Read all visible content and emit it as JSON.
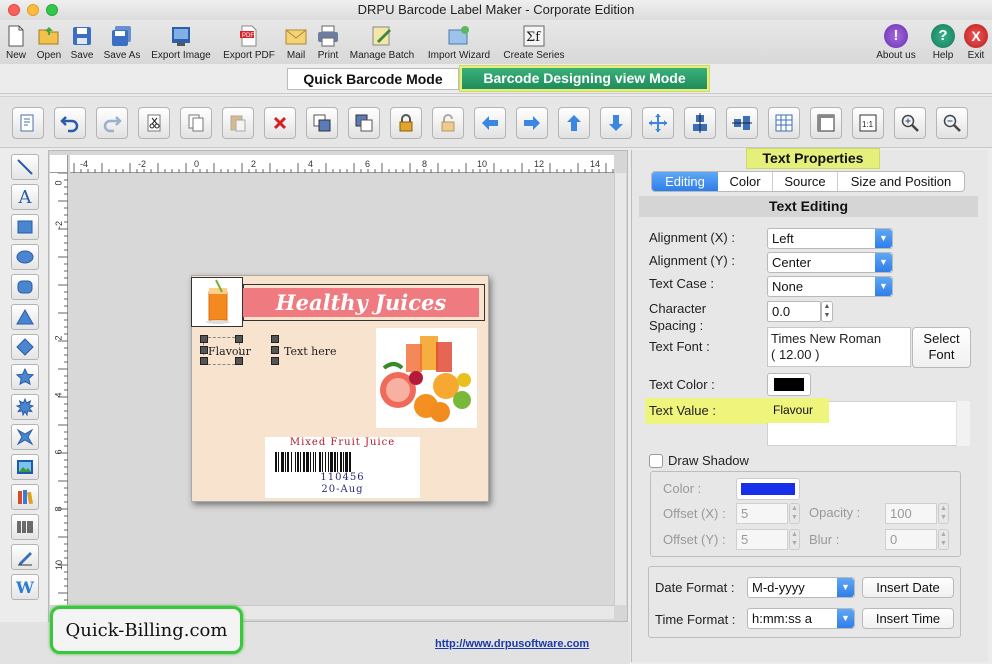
{
  "window": {
    "title": "DRPU Barcode Label Maker - Corporate Edition"
  },
  "toolbar": {
    "new": "New",
    "open": "Open",
    "save": "Save",
    "save_as": "Save As",
    "export_image": "Export Image",
    "export_pdf": "Export PDF",
    "mail": "Mail",
    "print": "Print",
    "manage_batch": "Manage Batch",
    "import_wizard": "Import Wizard",
    "create_series": "Create Series",
    "about_us": "About us",
    "help": "Help",
    "exit": "Exit"
  },
  "modes": {
    "quick": "Quick Barcode Mode",
    "designing": "Barcode Designing view Mode"
  },
  "ruler": {
    "h_ticks": [
      "-4",
      "-2",
      "0",
      "2",
      "4",
      "6",
      "8",
      "10",
      "12",
      "14"
    ],
    "v_ticks": [
      "0",
      "-2",
      "2",
      "4",
      "6",
      "8",
      "10"
    ]
  },
  "label": {
    "header": "Healthy Juices",
    "flavour_text": "Flavour",
    "text_here": "Text here",
    "barcode_title": "Mixed Fruit Juice",
    "barcode_number": "110456",
    "barcode_date": "20-Aug"
  },
  "panel": {
    "heading": "Text Properties",
    "tabs": [
      "Editing",
      "Color",
      "Source",
      "Size and Position"
    ],
    "section_title": "Text Editing",
    "alignment_x_label": "Alignment (X) :",
    "alignment_x_value": "Left",
    "alignment_y_label": "Alignment (Y) :",
    "alignment_y_value": "Center",
    "text_case_label": "Text Case :",
    "text_case_value": "None",
    "char_spacing_label_1": "Character",
    "char_spacing_label_2": "Spacing :",
    "char_spacing_value": "0.0",
    "text_font_label": "Text Font :",
    "text_font_value_1": "Times New Roman",
    "text_font_value_2": "( 12.00 )",
    "select_font_1": "Select",
    "select_font_2": "Font",
    "text_color_label": "Text Color :",
    "text_color": "#000000",
    "text_value_label": "Text Value :",
    "text_value": "Flavour",
    "draw_shadow": "Draw Shadow",
    "shadow_color_label": "Color :",
    "shadow_color": "#1530e8",
    "offset_x_label": "Offset (X) :",
    "offset_x_value": "5",
    "opacity_label": "Opacity :",
    "opacity_value": "100",
    "offset_y_label": "Offset (Y) :",
    "offset_y_value": "5",
    "blur_label": "Blur :",
    "blur_value": "0",
    "date_format_label": "Date Format :",
    "date_format_value": "M-d-yyyy",
    "insert_date": "Insert Date",
    "time_format_label": "Time Format :",
    "time_format_value": "h:mm:ss a",
    "insert_time": "Insert Time"
  },
  "footer": {
    "brand": "Quick-Billing.com",
    "url": "http://www.drpusoftware.com"
  }
}
